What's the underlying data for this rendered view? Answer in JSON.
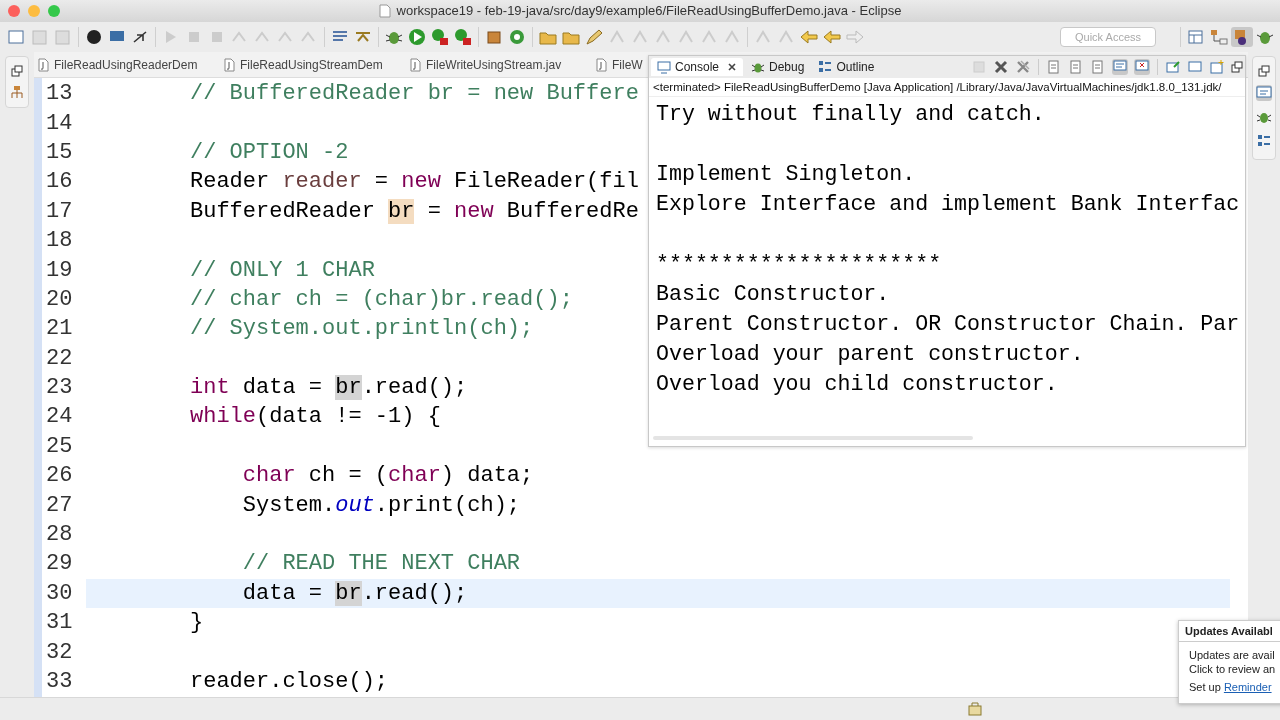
{
  "window": {
    "title": "workspace19 - feb-19-java/src/day9/example6/FileReadUsingBufferDemo.java - Eclipse"
  },
  "toolbar": {
    "quick_access": {
      "placeholder": "Quick Access"
    }
  },
  "editor": {
    "tabs": [
      {
        "label": "FileReadUsingReaderDem",
        "selected": false
      },
      {
        "label": "FileReadUsingStreamDem",
        "selected": false
      },
      {
        "label": "FileWriteUsingStream.jav",
        "selected": false
      },
      {
        "label": "FileW",
        "selected": false
      }
    ],
    "lines": [
      {
        "number": "13",
        "current": false,
        "tokens": [
          {
            "kind": "comment",
            "text": "// BufferedReader br = new Buffere"
          }
        ]
      },
      {
        "number": "14",
        "current": false
      },
      {
        "number": "15",
        "current": false,
        "tokens": [
          {
            "kind": "comment",
            "text": "// OPTION -2"
          }
        ]
      },
      {
        "number": "16",
        "current": false,
        "tokens": [
          {
            "kind": "plain",
            "text": "Reader "
          },
          {
            "kind": "local",
            "text": "reader"
          },
          {
            "kind": "plain",
            "text": " = "
          },
          {
            "kind": "keyword",
            "text": "new"
          },
          {
            "kind": "plain",
            "text": " FileReader(fil"
          }
        ]
      },
      {
        "number": "17",
        "current": false,
        "tokens": [
          {
            "kind": "plain",
            "text": "BufferedReader "
          },
          {
            "kind": "write",
            "text": "br"
          },
          {
            "kind": "plain",
            "text": " = "
          },
          {
            "kind": "keyword",
            "text": "new"
          },
          {
            "kind": "plain",
            "text": " BufferedRe"
          }
        ]
      },
      {
        "number": "18",
        "current": false
      },
      {
        "number": "19",
        "current": false,
        "tokens": [
          {
            "kind": "comment",
            "text": "// ONLY 1 CHAR"
          }
        ]
      },
      {
        "number": "20",
        "current": false,
        "tokens": [
          {
            "kind": "comment",
            "text": "// char ch = (char)br.read();"
          }
        ]
      },
      {
        "number": "21",
        "current": false,
        "tokens": [
          {
            "kind": "comment",
            "text": "// System.out.println(ch);"
          }
        ]
      },
      {
        "number": "22",
        "current": false
      },
      {
        "number": "23",
        "current": false,
        "tokens": [
          {
            "kind": "keyword",
            "text": "int"
          },
          {
            "kind": "plain",
            "text": " data = "
          },
          {
            "kind": "read",
            "text": "br"
          },
          {
            "kind": "plain",
            "text": ".read();"
          }
        ]
      },
      {
        "number": "24",
        "current": false,
        "tokens": [
          {
            "kind": "keyword",
            "text": "while"
          },
          {
            "kind": "plain",
            "text": "(data != -1) {"
          }
        ],
        "children": [
          {
            "number": "25",
            "current": false
          },
          {
            "number": "26",
            "current": false,
            "tokens": [
              {
                "kind": "keyword",
                "text": "char"
              },
              {
                "kind": "plain",
                "text": " ch = ("
              },
              {
                "kind": "keyword",
                "text": "char"
              },
              {
                "kind": "plain",
                "text": ") data;"
              }
            ]
          },
          {
            "number": "27",
            "current": false,
            "tokens": [
              {
                "kind": "plain",
                "text": "System."
              },
              {
                "kind": "field",
                "text": "out"
              },
              {
                "kind": "plain",
                "text": ".print(ch);"
              }
            ]
          },
          {
            "number": "28",
            "current": false
          },
          {
            "number": "29",
            "current": false,
            "tokens": [
              {
                "kind": "comment",
                "text": "// READ THE NEXT CHAR"
              }
            ]
          },
          {
            "number": "30",
            "current": true,
            "tokens": [
              {
                "kind": "plain",
                "text": "data = "
              },
              {
                "kind": "read",
                "text": "br"
              },
              {
                "kind": "plain",
                "text": ".read();"
              }
            ]
          }
        ]
      },
      {
        "number": "31",
        "current": false,
        "tokens": [
          {
            "kind": "plain",
            "text": "}"
          }
        ]
      },
      {
        "number": "32",
        "current": false
      },
      {
        "number": "33",
        "current": false,
        "tokens": [
          {
            "kind": "plain",
            "text": "reader.close();"
          }
        ]
      }
    ]
  },
  "console": {
    "tabs": [
      {
        "label": "Console",
        "selected": true,
        "kind": "console"
      },
      {
        "label": "Debug",
        "selected": false,
        "kind": "debug"
      },
      {
        "label": "Outline",
        "selected": false,
        "kind": "outline"
      }
    ],
    "status": "<terminated> FileReadUsingBufferDemo [Java Application] /Library/Java/JavaVirtualMachines/jdk1.8.0_131.jdk/",
    "blocks": [
      {
        "lines": [
          "Try without finally and catch."
        ]
      },
      {
        "lines": [
          "Implement Singleton.",
          "Explore Interface and implement Bank Interfac"
        ]
      },
      {
        "lines": [
          "**********************",
          "Basic Constructor.",
          "Parent Constructor. OR Constructor Chain. Par",
          "Overload your parent constructor.",
          "Overload you child constructor."
        ]
      }
    ]
  },
  "notification": {
    "title": "Updates Availabl",
    "lines": [
      "Updates are avail",
      "Click to review an"
    ],
    "setup_text": "Set up",
    "link": "Reminder"
  }
}
